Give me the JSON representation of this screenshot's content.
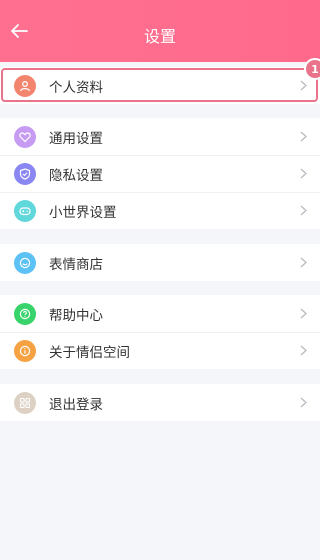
{
  "header": {
    "title": "设置"
  },
  "groups": [
    {
      "items": [
        {
          "label": "个人资料",
          "icon": "person-icon",
          "color": "#f3846d"
        }
      ]
    },
    {
      "items": [
        {
          "label": "通用设置",
          "icon": "heart-icon",
          "color": "#c79bf2"
        },
        {
          "label": "隐私设置",
          "icon": "shield-icon",
          "color": "#8a87f3"
        },
        {
          "label": "小世界设置",
          "icon": "gamepad-icon",
          "color": "#5fd7db"
        }
      ]
    },
    {
      "items": [
        {
          "label": "表情商店",
          "icon": "smiley-icon",
          "color": "#5cc2f5"
        }
      ]
    },
    {
      "items": [
        {
          "label": "帮助中心",
          "icon": "question-icon",
          "color": "#38d36b"
        },
        {
          "label": "关于情侣空间",
          "icon": "info-icon",
          "color": "#f6a142"
        }
      ]
    },
    {
      "items": [
        {
          "label": "退出登录",
          "icon": "grid-icon",
          "color": "#dcd1c3"
        }
      ]
    }
  ],
  "annotation": {
    "badge_text": "1",
    "color": "#e8738b"
  }
}
